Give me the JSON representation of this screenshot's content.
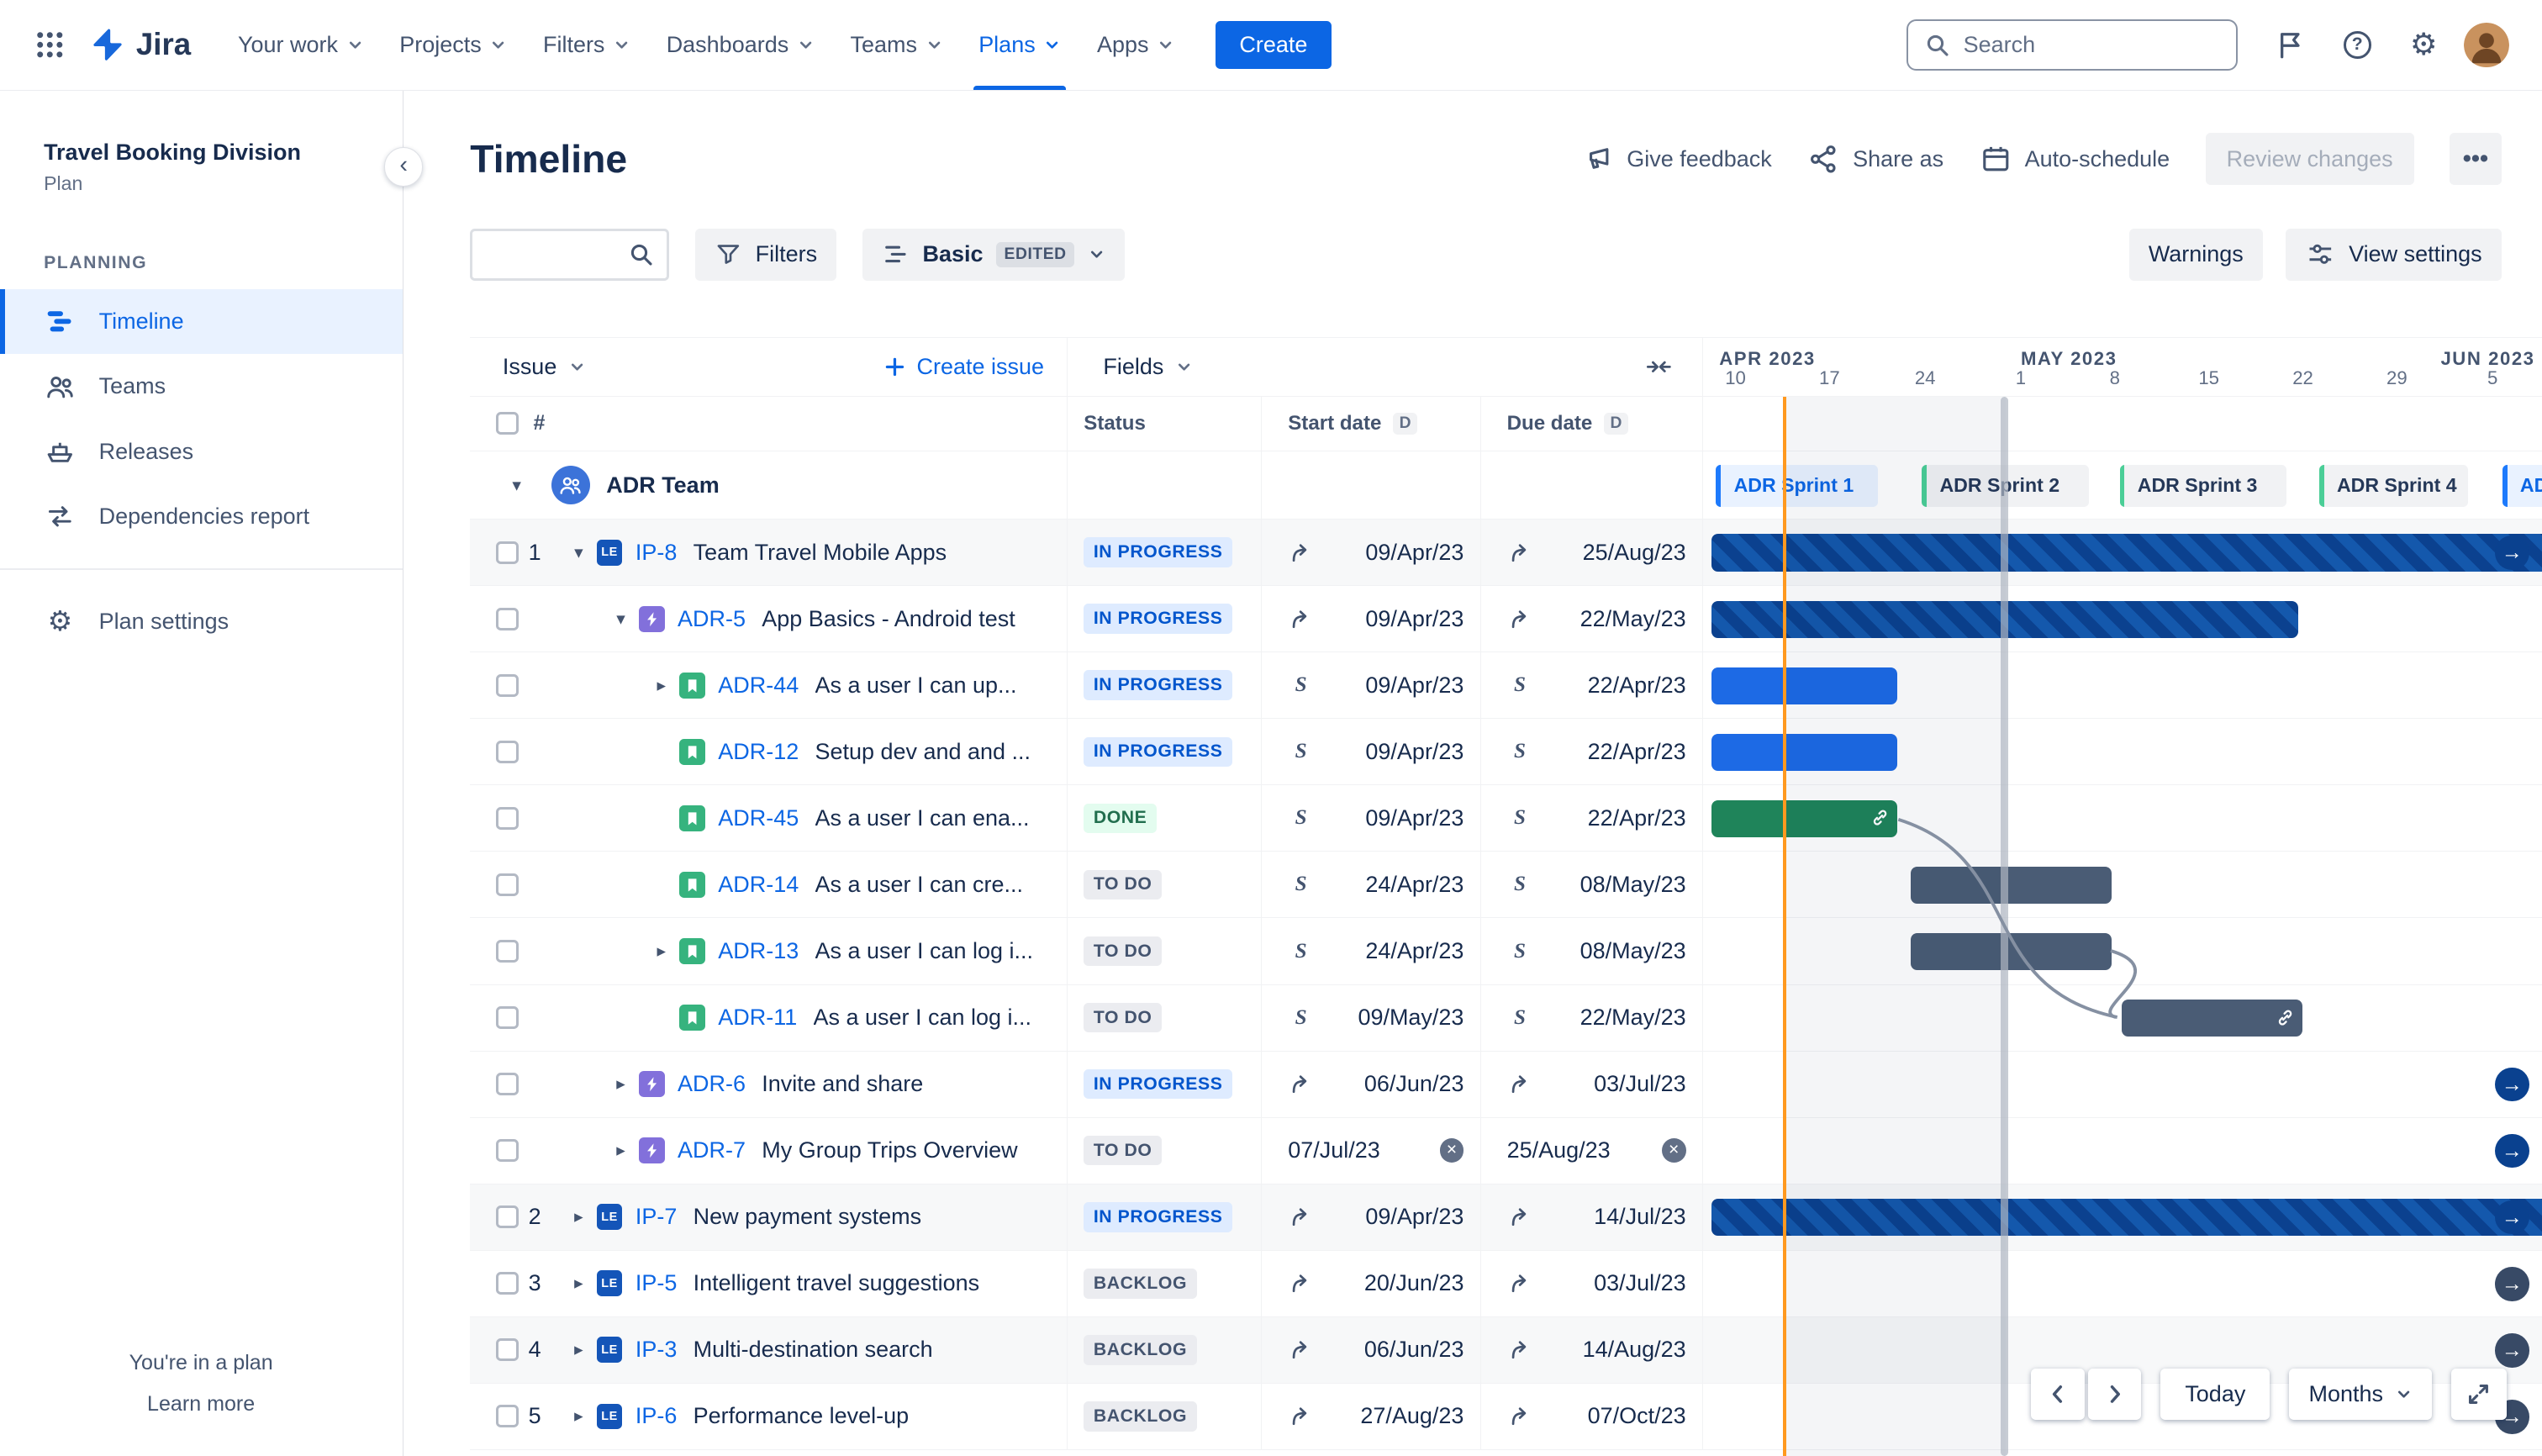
{
  "topnav": {
    "logo": "Jira",
    "items": [
      {
        "label": "Your work",
        "active": false
      },
      {
        "label": "Projects",
        "active": false
      },
      {
        "label": "Filters",
        "active": false
      },
      {
        "label": "Dashboards",
        "active": false
      },
      {
        "label": "Teams",
        "active": false
      },
      {
        "label": "Plans",
        "active": true
      },
      {
        "label": "Apps",
        "active": false
      }
    ],
    "create_label": "Create",
    "search_placeholder": "Search"
  },
  "sidebar": {
    "plan_name": "Travel Booking Division",
    "plan_type": "Plan",
    "section_label": "PLANNING",
    "items": [
      {
        "label": "Timeline",
        "icon": "timeline",
        "active": true
      },
      {
        "label": "Teams",
        "icon": "teams",
        "active": false
      },
      {
        "label": "Releases",
        "icon": "releases",
        "active": false
      },
      {
        "label": "Dependencies report",
        "icon": "dependencies",
        "active": false
      }
    ],
    "settings_label": "Plan settings",
    "footer_note": "You're in a plan",
    "footer_link": "Learn more"
  },
  "header": {
    "title": "Timeline",
    "give_feedback": "Give feedback",
    "share_as": "Share as",
    "auto_schedule": "Auto-schedule",
    "review_changes": "Review changes"
  },
  "toolbar": {
    "filters_label": "Filters",
    "view_label": "Basic",
    "view_badge": "EDITED",
    "warnings_label": "Warnings",
    "view_settings_label": "View settings"
  },
  "table": {
    "issue_label": "Issue",
    "create_issue_label": "Create issue",
    "fields_label": "Fields",
    "s_icon_label": "S",
    "columns": {
      "hash": "#",
      "status": "Status",
      "start": "Start date",
      "due": "Due date",
      "d_badge": "D"
    },
    "group": {
      "name": "ADR Team"
    },
    "rows": [
      {
        "num": "1",
        "level": 1,
        "chevron": "down",
        "type": "initiative",
        "type_label": "LE",
        "key": "IP-8",
        "title": "Team Travel Mobile Apps",
        "status": "IN PROGRESS",
        "status_kind": "inprogress",
        "start_icon": "rollup",
        "start": "09/Apr/23",
        "due_icon": "rollup",
        "due": "25/Aug/23",
        "shaded": true
      },
      {
        "num": "",
        "level": 2,
        "chevron": "down",
        "type": "epic",
        "type_label": "",
        "key": "ADR-5",
        "title": "App Basics - Android test",
        "status": "IN PROGRESS",
        "status_kind": "inprogress",
        "start_icon": "rollup",
        "start": "09/Apr/23",
        "due_icon": "rollup",
        "due": "22/May/23",
        "shaded": false
      },
      {
        "num": "",
        "level": 3,
        "chevron": "right",
        "type": "story",
        "type_label": "",
        "key": "ADR-44",
        "title": "As a user I can up...",
        "status": "IN PROGRESS",
        "status_kind": "inprogress",
        "start_icon": "sprint",
        "start": "09/Apr/23",
        "due_icon": "sprint",
        "due": "22/Apr/23",
        "shaded": false
      },
      {
        "num": "",
        "level": 3,
        "chevron": "none",
        "type": "story",
        "type_label": "",
        "key": "ADR-12",
        "title": "Setup dev and and ...",
        "status": "IN PROGRESS",
        "status_kind": "inprogress",
        "start_icon": "sprint",
        "start": "09/Apr/23",
        "due_icon": "sprint",
        "due": "22/Apr/23",
        "shaded": false
      },
      {
        "num": "",
        "level": 3,
        "chevron": "none",
        "type": "story",
        "type_label": "",
        "key": "ADR-45",
        "title": "As a user I can ena...",
        "status": "DONE",
        "status_kind": "done",
        "start_icon": "sprint",
        "start": "09/Apr/23",
        "due_icon": "sprint",
        "due": "22/Apr/23",
        "shaded": false
      },
      {
        "num": "",
        "level": 3,
        "chevron": "none",
        "type": "story",
        "type_label": "",
        "key": "ADR-14",
        "title": "As a user I can cre...",
        "status": "TO DO",
        "status_kind": "todo",
        "start_icon": "sprint",
        "start": "24/Apr/23",
        "due_icon": "sprint",
        "due": "08/May/23",
        "shaded": false
      },
      {
        "num": "",
        "level": 3,
        "chevron": "right",
        "type": "story",
        "type_label": "",
        "key": "ADR-13",
        "title": "As a user I can log i...",
        "status": "TO DO",
        "status_kind": "todo",
        "start_icon": "sprint",
        "start": "24/Apr/23",
        "due_icon": "sprint",
        "due": "08/May/23",
        "shaded": false
      },
      {
        "num": "",
        "level": 3,
        "chevron": "none",
        "type": "story",
        "type_label": "",
        "key": "ADR-11",
        "title": "As a user I can log i...",
        "status": "TO DO",
        "status_kind": "todo",
        "start_icon": "sprint",
        "start": "09/May/23",
        "due_icon": "sprint",
        "due": "22/May/23",
        "shaded": false
      },
      {
        "num": "",
        "level": 2,
        "chevron": "right",
        "type": "epic",
        "type_label": "",
        "key": "ADR-6",
        "title": "Invite and share",
        "status": "IN PROGRESS",
        "status_kind": "inprogress",
        "start_icon": "rollup",
        "start": "06/Jun/23",
        "due_icon": "rollup",
        "due": "03/Jul/23",
        "shaded": false
      },
      {
        "num": "",
        "level": 2,
        "chevron": "right",
        "type": "epic",
        "type_label": "",
        "key": "ADR-7",
        "title": "My Group Trips Overview",
        "status": "TO DO",
        "status_kind": "todo",
        "start_icon": "clear",
        "start": "07/Jul/23",
        "due_icon": "clear",
        "due": "25/Aug/23",
        "shaded": false
      },
      {
        "num": "2",
        "level": 1,
        "chevron": "right",
        "type": "initiative",
        "type_label": "LE",
        "key": "IP-7",
        "title": "New payment systems",
        "status": "IN PROGRESS",
        "status_kind": "inprogress",
        "start_icon": "rollup",
        "start": "09/Apr/23",
        "due_icon": "rollup",
        "due": "14/Jul/23",
        "shaded": true
      },
      {
        "num": "3",
        "level": 1,
        "chevron": "right",
        "type": "initiative",
        "type_label": "LE",
        "key": "IP-5",
        "title": "Intelligent travel suggestions",
        "status": "BACKLOG",
        "status_kind": "backlog",
        "start_icon": "rollup",
        "start": "20/Jun/23",
        "due_icon": "rollup",
        "due": "03/Jul/23",
        "shaded": false
      },
      {
        "num": "4",
        "level": 1,
        "chevron": "right",
        "type": "initiative",
        "type_label": "LE",
        "key": "IP-3",
        "title": "Multi-destination search",
        "status": "BACKLOG",
        "status_kind": "backlog",
        "start_icon": "rollup",
        "start": "06/Jun/23",
        "due_icon": "rollup",
        "due": "14/Aug/23",
        "shaded": true
      },
      {
        "num": "5",
        "level": 1,
        "chevron": "right",
        "type": "initiative",
        "type_label": "LE",
        "key": "IP-6",
        "title": "Performance level-up",
        "status": "BACKLOG",
        "status_kind": "backlog",
        "start_icon": "rollup",
        "start": "27/Aug/23",
        "due_icon": "rollup",
        "due": "07/Oct/23",
        "shaded": false
      }
    ]
  },
  "timeline": {
    "months": [
      {
        "label": "APR 2023",
        "ticks": [
          "10",
          "17",
          "24"
        ]
      },
      {
        "label": "MAY 2023",
        "ticks": [
          "1",
          "8",
          "15",
          "22",
          "29"
        ]
      },
      {
        "label": "JUN 2023",
        "ticks": [
          "5"
        ]
      }
    ],
    "sprints": [
      {
        "label": "ADR Sprint 1",
        "active": true
      },
      {
        "label": "ADR Sprint 2",
        "active": false
      },
      {
        "label": "ADR Sprint 3",
        "active": false
      },
      {
        "label": "ADR Sprint 4",
        "active": false
      },
      {
        "label": "AD",
        "active": true
      }
    ],
    "controls": {
      "today_label": "Today",
      "zoom_label": "Months"
    }
  },
  "colors": {
    "brand_blue": "#0C66E4",
    "today_line": "#FF991F",
    "bar_parent_striped": "#0B418F",
    "bar_in_progress": "#1D6AE5",
    "bar_done": "#1F845A",
    "bar_todo": "#4A5C75",
    "sprint_active_bg": "#E9F2FF"
  }
}
